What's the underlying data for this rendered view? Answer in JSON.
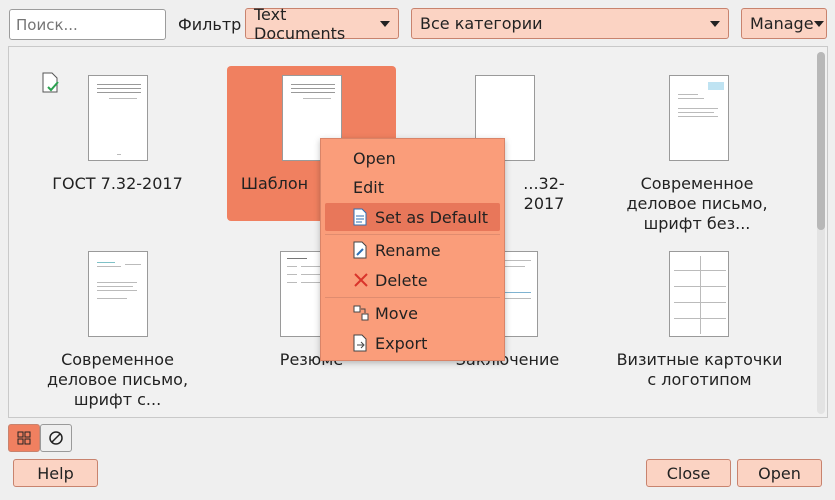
{
  "toolbar": {
    "search_placeholder": "Поиск...",
    "filter_label": "Фильтр",
    "doc_type": "Text Documents",
    "category": "Все категории",
    "manage_label": "Manage"
  },
  "templates": [
    {
      "label": "ГОСТ 7.32-2017",
      "default": true
    },
    {
      "label": "Шаблон",
      "selected": true
    },
    {
      "label": "...32-2017"
    },
    {
      "label": "Современное деловое письмо, шрифт без..."
    },
    {
      "label": "Современное деловое письмо, шрифт с..."
    },
    {
      "label": "Резюме"
    },
    {
      "label": "Заключение"
    },
    {
      "label": "Визитные карточки с логотипом"
    }
  ],
  "context_menu": {
    "open": "Open",
    "edit": "Edit",
    "set_default": "Set as Default",
    "rename": "Rename",
    "delete": "Delete",
    "move": "Move",
    "export": "Export"
  },
  "footer": {
    "help": "Help",
    "close": "Close",
    "open": "Open"
  },
  "colors": {
    "accent": "#f08060",
    "menu_bg": "#fa9d7a",
    "button_bg": "#fbd3c3"
  }
}
